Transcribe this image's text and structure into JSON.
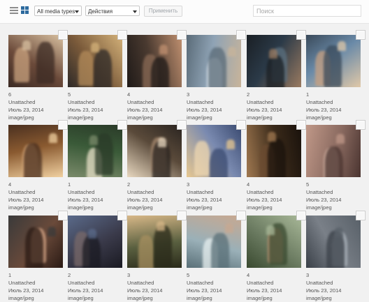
{
  "toolbar": {
    "media_filter": "All media types",
    "bulk_action": "Действия",
    "apply_label": "Применить",
    "search_placeholder": "Поиск"
  },
  "icons": {
    "list_view": "list-view-icon",
    "grid_view": "grid-view-icon"
  },
  "items": [
    {
      "num": "6",
      "status": "Unattached",
      "date": "Июль 23, 2014",
      "type": "image/jpeg"
    },
    {
      "num": "5",
      "status": "Unattached",
      "date": "Июль 23, 2014",
      "type": "image/jpeg"
    },
    {
      "num": "4",
      "status": "Unattached",
      "date": "Июль 23, 2014",
      "type": "image/jpeg"
    },
    {
      "num": "3",
      "status": "Unattached",
      "date": "Июль 23, 2014",
      "type": "image/jpeg"
    },
    {
      "num": "2",
      "status": "Unattached",
      "date": "Июль 23, 2014",
      "type": "image/jpeg"
    },
    {
      "num": "1",
      "status": "Unattached",
      "date": "Июль 23, 2014",
      "type": "image/jpeg"
    },
    {
      "num": "4",
      "status": "Unattached",
      "date": "Июль 23, 2014",
      "type": "image/jpeg"
    },
    {
      "num": "1",
      "status": "Unattached",
      "date": "Июль 23, 2014",
      "type": "image/jpeg"
    },
    {
      "num": "2",
      "status": "Unattached",
      "date": "Июль 23, 2014",
      "type": "image/jpeg"
    },
    {
      "num": "3",
      "status": "Unattached",
      "date": "Июль 23, 2014",
      "type": "image/jpeg"
    },
    {
      "num": "4",
      "status": "Unattached",
      "date": "Июль 23, 2014",
      "type": "image/jpeg"
    },
    {
      "num": "5",
      "status": "Unattached",
      "date": "Июль 23, 2014",
      "type": "image/jpeg"
    },
    {
      "num": "1",
      "status": "Unattached",
      "date": "Июль 23, 2014",
      "type": "image/jpeg"
    },
    {
      "num": "2",
      "status": "Unattached",
      "date": "Июль 23, 2014",
      "type": "image/jpeg"
    },
    {
      "num": "3",
      "status": "Unattached",
      "date": "Июль 23, 2014",
      "type": "image/jpeg"
    },
    {
      "num": "5",
      "status": "Unattached",
      "date": "Июль 23, 2014",
      "type": "image/jpeg"
    },
    {
      "num": "4",
      "status": "Unattached",
      "date": "Июль 23, 2014",
      "type": "image/jpeg"
    },
    {
      "num": "3",
      "status": "Unattached",
      "date": "Июль 23, 2014",
      "type": "image/jpeg"
    }
  ]
}
